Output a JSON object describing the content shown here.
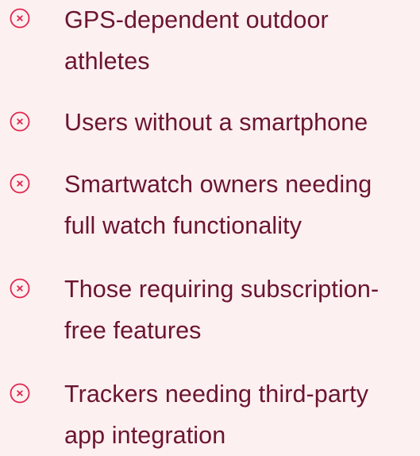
{
  "icon_name": "close-circle-icon",
  "colors": {
    "background": "#fdf0f0",
    "text": "#6b1530",
    "icon": "#e0284f"
  },
  "items": [
    {
      "text": "GPS-dependent outdoor\nathletes"
    },
    {
      "text": "Users without a smartphone"
    },
    {
      "text": "Smartwatch owners needing\nfull watch functionality"
    },
    {
      "text": "Those requiring subscription-\nfree features"
    },
    {
      "text": "Trackers needing third-party\napp integration"
    }
  ]
}
